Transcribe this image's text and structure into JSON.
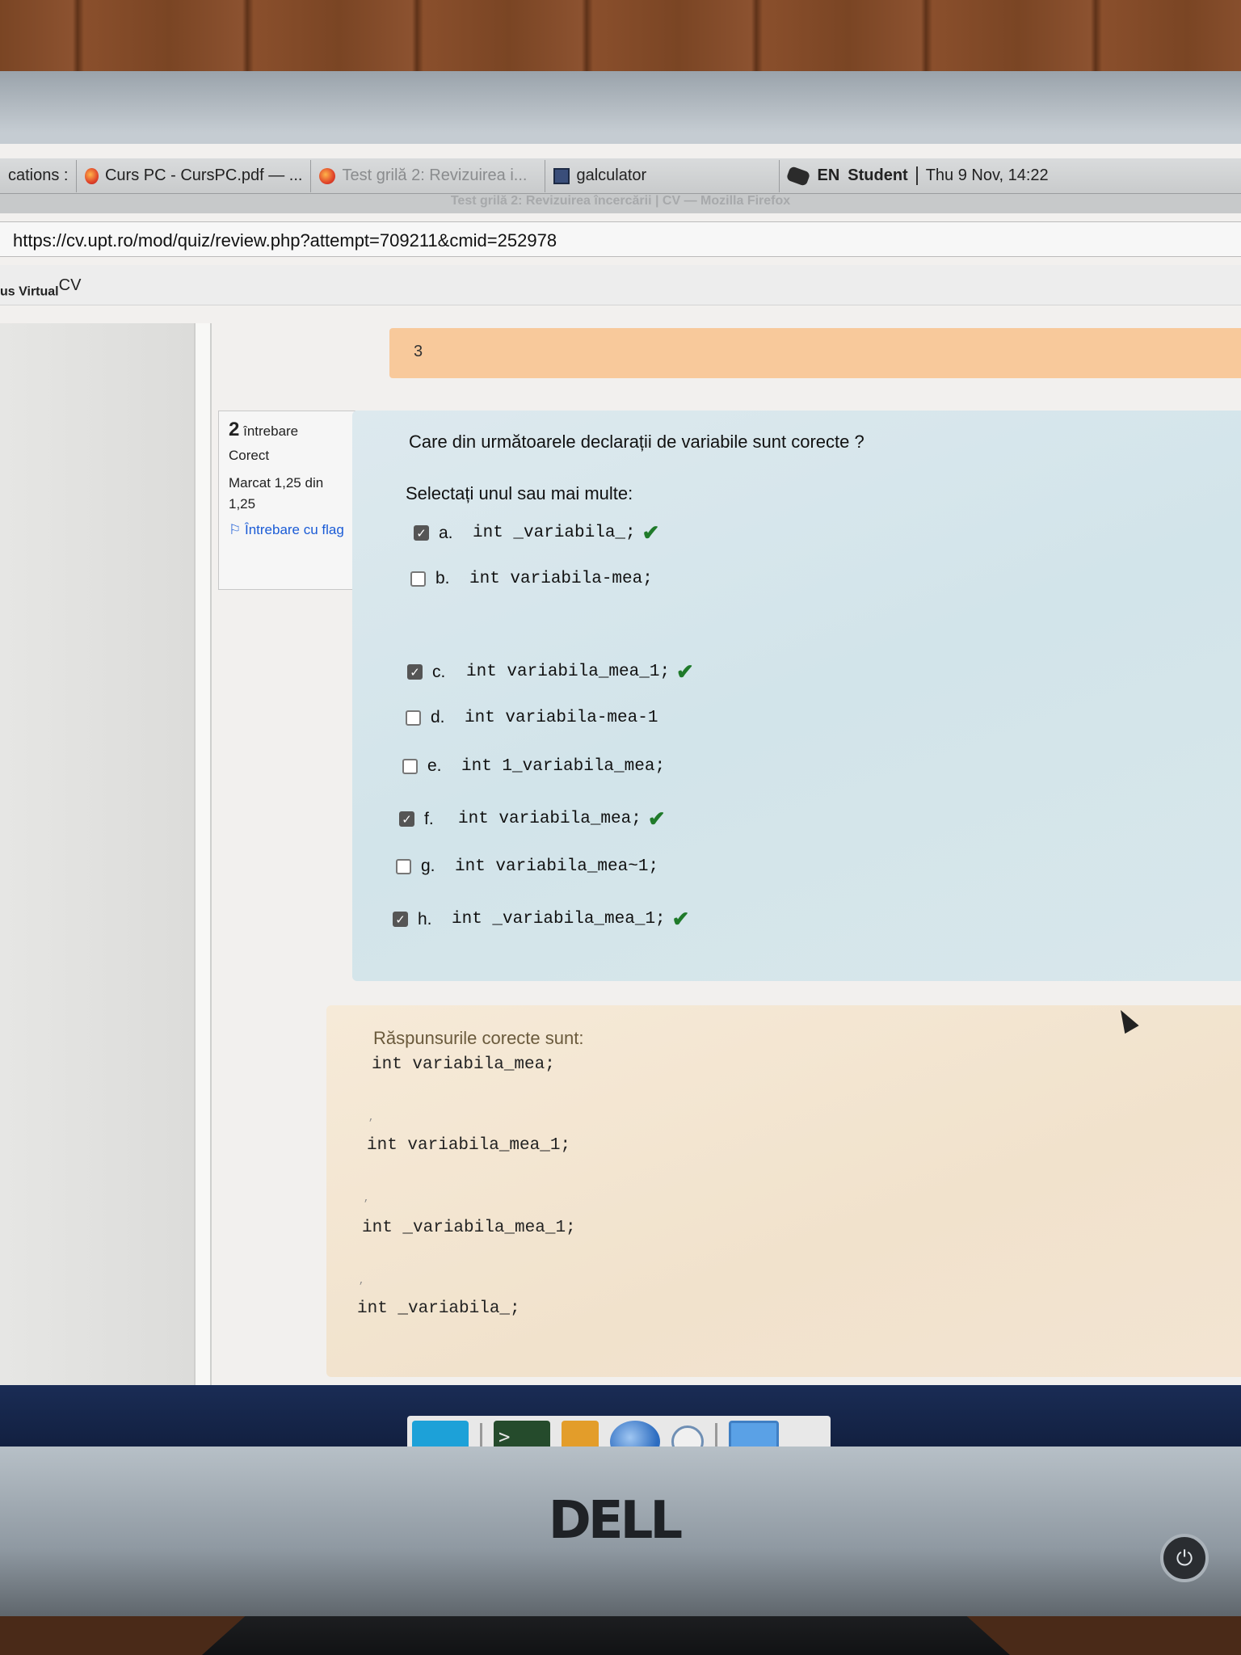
{
  "taskbar": {
    "items": [
      {
        "label": "cations :",
        "active": true
      },
      {
        "label": "Curs PC - CursPC.pdf — ...",
        "active": true
      },
      {
        "label": "Test grilă 2: Revizuirea i...",
        "active": false
      },
      {
        "label": "galculator",
        "active": true
      }
    ],
    "keyboard_layout": "EN",
    "user": "Student",
    "clock": "Thu  9 Nov, 14:22"
  },
  "window": {
    "title": "Test grilă 2: Revizuirea încercării | CV — Mozilla Firefox"
  },
  "urlbar": {
    "url": "https://cv.upt.ro/mod/quiz/review.php?attempt=709211&cmid=252978"
  },
  "site": {
    "name": "us Virtual",
    "logo_sup": "CV"
  },
  "summary_bar": {
    "value": "3"
  },
  "question_info": {
    "number": "2",
    "label": "întrebare",
    "state": "Corect",
    "marks": "Marcat 1,25 din 1,25",
    "flag_label": "Întrebare cu flag"
  },
  "question": {
    "text": "Care din următoarele declarații de variabile sunt corecte ?",
    "prompt": "Selectați unul sau mai multe:",
    "options": [
      {
        "letter": "a.",
        "code": "int _variabila_;",
        "checked": true,
        "correct_mark": "✔"
      },
      {
        "letter": "b.",
        "code": "int variabila-mea;",
        "checked": false,
        "correct_mark": ""
      },
      {
        "letter": "c.",
        "code": "int variabila_mea_1;",
        "checked": true,
        "correct_mark": "✔"
      },
      {
        "letter": "d.",
        "code": "int variabila-mea-1",
        "checked": false,
        "correct_mark": ""
      },
      {
        "letter": "e.",
        "code": "int 1_variabila_mea;",
        "checked": false,
        "correct_mark": ""
      },
      {
        "letter": "f.",
        "code": "int variabila_mea;",
        "checked": true,
        "correct_mark": "✔"
      },
      {
        "letter": "g.",
        "code": "int variabila_mea~1;",
        "checked": false,
        "correct_mark": ""
      },
      {
        "letter": "h.",
        "code": "int _variabila_mea_1;",
        "checked": true,
        "correct_mark": "✔"
      }
    ]
  },
  "answers": {
    "title": "Răspunsurile corecte sunt:",
    "lines": [
      "int variabila_mea;",
      "int variabila_mea_1;",
      "int _variabila_mea_1;",
      "int _variabila_;"
    ],
    "separators": [
      ",",
      ",",
      ","
    ]
  },
  "dock": {
    "icons": [
      "blue-app-icon",
      "terminal-icon",
      "files-icon",
      "browser-globe-icon",
      "search-icon",
      "window-icon"
    ],
    "terminal_glyph": ">_"
  },
  "monitor": {
    "brand": "DELL"
  },
  "colors": {
    "question_panel": "#d2e4ea",
    "answer_panel": "#f1e2cc",
    "summary_bar": "#f8c99b",
    "check_green": "#1f7a2a",
    "flag_link": "#1a5bd6"
  }
}
